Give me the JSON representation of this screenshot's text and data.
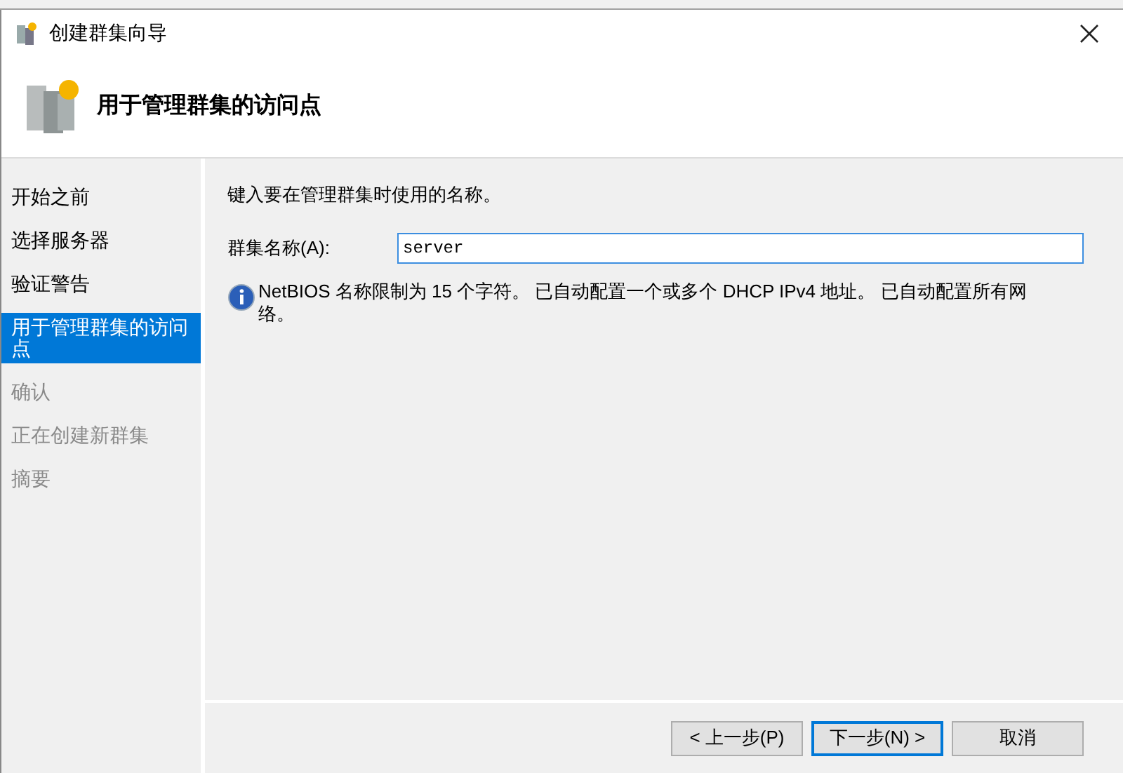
{
  "window": {
    "title": "创建群集向导"
  },
  "header": {
    "title": "用于管理群集的访问点"
  },
  "steps": [
    {
      "label": "开始之前",
      "selected": false,
      "disabled": false
    },
    {
      "label": "选择服务器",
      "selected": false,
      "disabled": false
    },
    {
      "label": "验证警告",
      "selected": false,
      "disabled": false
    },
    {
      "label": "用于管理群集的访问点",
      "selected": true,
      "disabled": false
    },
    {
      "label": "确认",
      "selected": false,
      "disabled": true
    },
    {
      "label": "正在创建新群集",
      "selected": false,
      "disabled": true
    },
    {
      "label": "摘要",
      "selected": false,
      "disabled": true
    }
  ],
  "content": {
    "instruction": "键入要在管理群集时使用的名称。",
    "field_label": "群集名称(A):",
    "field_value": "server",
    "info": "NetBIOS 名称限制为 15 个字符。 已自动配置一个或多个 DHCP IPv4 地址。 已自动配置所有网络。"
  },
  "buttons": [
    {
      "label": "< 上一步(P)",
      "default": false
    },
    {
      "label": "下一步(N) >",
      "default": true
    },
    {
      "label": "取消",
      "default": false
    }
  ]
}
